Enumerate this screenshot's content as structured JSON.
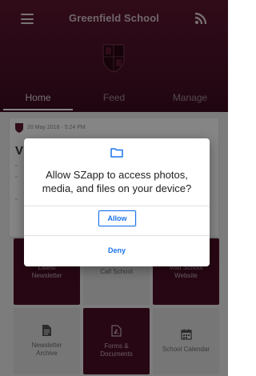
{
  "header": {
    "title": "Greenfield School",
    "icons": {
      "menu": "hamburger-menu-icon",
      "feed": "rss-feed-icon",
      "logo": "school-crest-logo"
    }
  },
  "tabs": [
    {
      "label": "Home",
      "active": true
    },
    {
      "label": "Feed",
      "active": false
    },
    {
      "label": "Manage",
      "active": false
    }
  ],
  "post": {
    "date": "20 May 2018 - 5:24 PM",
    "title_fragment": "V"
  },
  "tiles": [
    {
      "label": "Latest\nNewsletter",
      "style": "dark",
      "icon": ""
    },
    {
      "label": "Call School",
      "style": "light",
      "icon": ""
    },
    {
      "label": "Visit School\nWebsite",
      "style": "dark",
      "icon": ""
    },
    {
      "label": "Newsletter\nArchive",
      "style": "light",
      "icon": "document-icon"
    },
    {
      "label": "Forms &\nDocuments",
      "style": "dark",
      "icon": "pdf-icon"
    },
    {
      "label": "School Calendar",
      "style": "light",
      "icon": "calendar-icon"
    }
  ],
  "dialog": {
    "message": "Allow SZapp to access photos, media, and files on your device?",
    "allow_label": "Allow",
    "deny_label": "Deny",
    "icon": "folder-icon"
  },
  "colors": {
    "brand_maroon": "#4d0f28",
    "dialog_accent": "#1a73e8"
  }
}
